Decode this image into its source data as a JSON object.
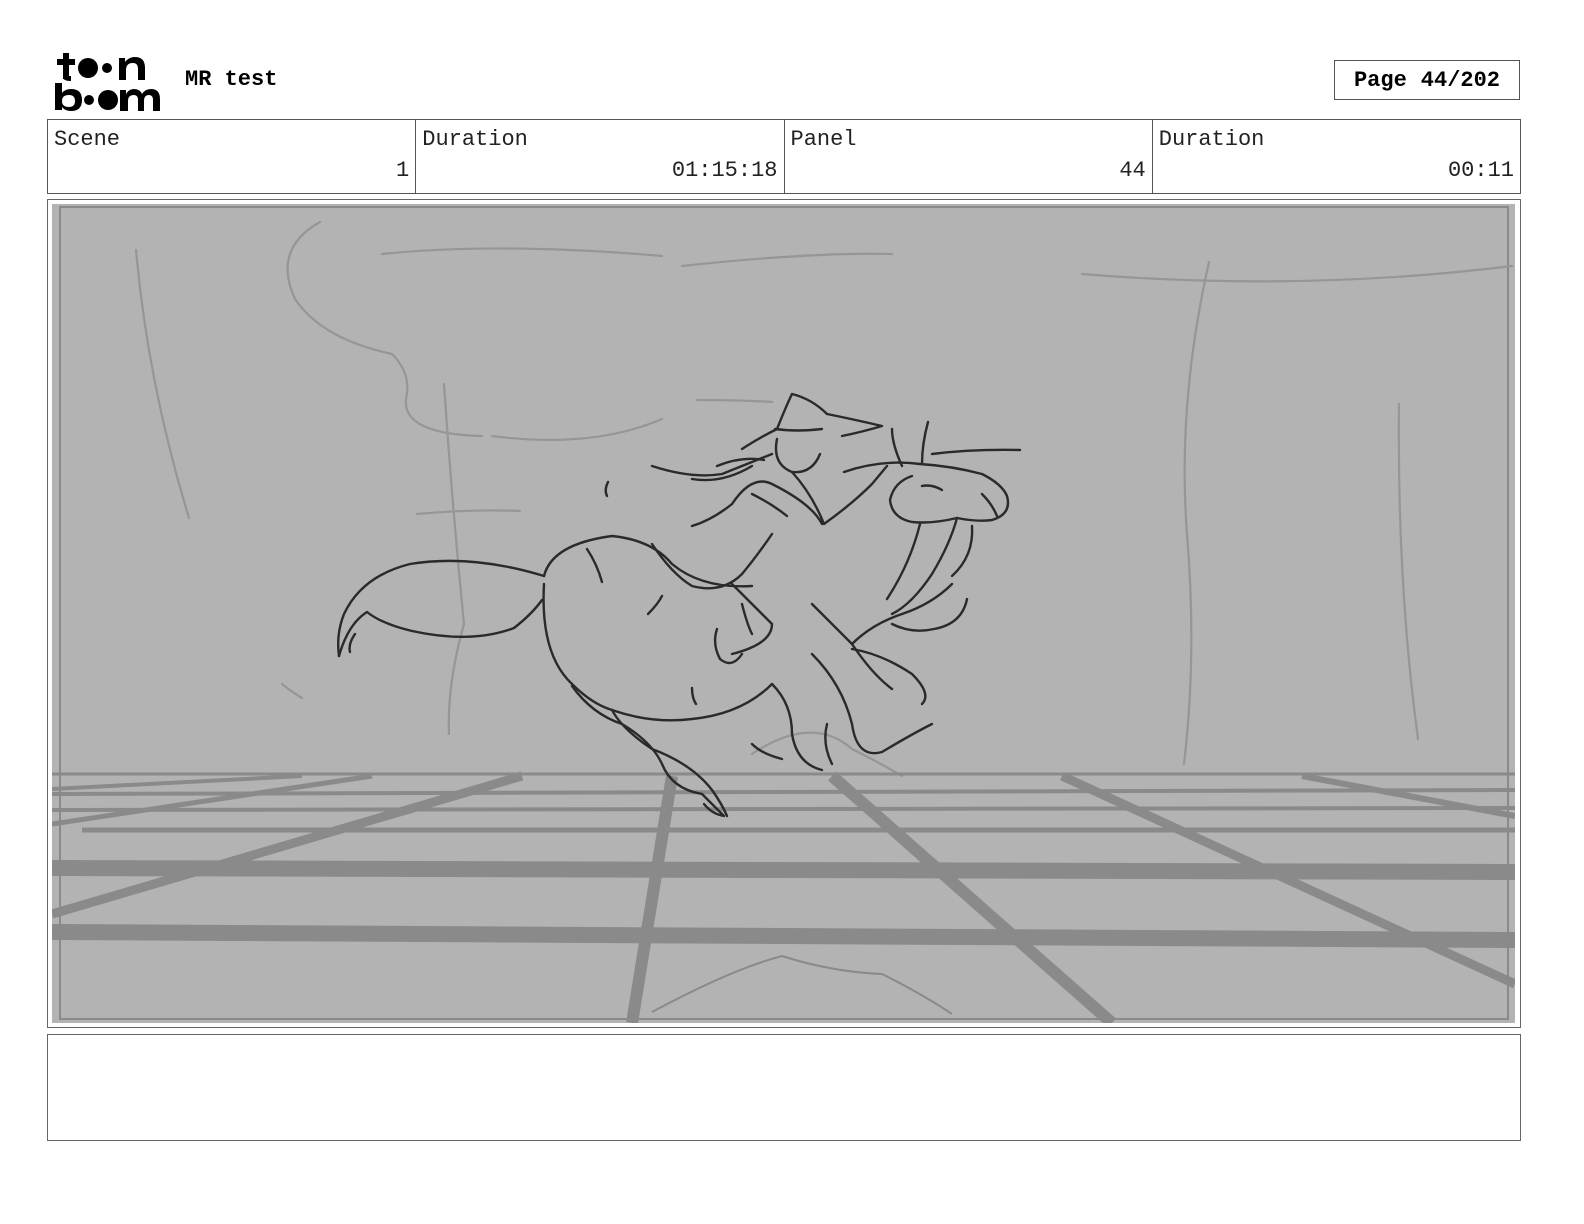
{
  "header": {
    "logo_text": "toon boom",
    "project_title": "MR test",
    "page_label": "Page",
    "page_number": "44/202"
  },
  "info": {
    "scene_label": "Scene",
    "scene_value": "1",
    "scene_duration_label": "Duration",
    "scene_duration_value": "01:15:18",
    "panel_label": "Panel",
    "panel_value": "44",
    "panel_duration_label": "Duration",
    "panel_duration_value": "00:11"
  },
  "panel": {
    "background_color": "#b3b3b3",
    "sketch_color": "#2a2a2a",
    "floor_grid_color": "#8a8a8a",
    "icon": "horse-rider-sketch-icon"
  },
  "notes": {
    "text": ""
  }
}
